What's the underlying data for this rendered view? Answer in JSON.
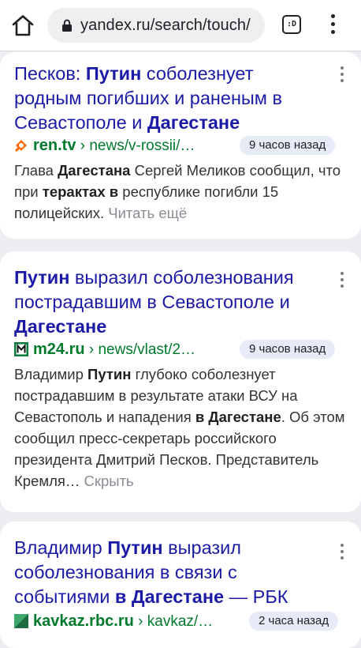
{
  "browser": {
    "url": "yandex.ru/search/touch/",
    "tab_label": ":D"
  },
  "results": [
    {
      "title_parts": [
        "Песков: ",
        "Путин",
        " соболезнует родным погибших и раненым в Севастополе и ",
        "Дагестане"
      ],
      "domain": "ren.tv",
      "path": "› news/v-rossii/…",
      "time": "9 часов назад",
      "snippet_parts": [
        "Глава ",
        "Дагестана",
        " Сергей Меликов сообщил, что при ",
        "терактах в",
        " республике погибли 15 полицейских."
      ],
      "more": "Читать ещё"
    },
    {
      "title_parts": [
        "Путин",
        " выразил соболезнования пострадавшим в Севастополе и ",
        "Дагестане"
      ],
      "domain": "m24.ru",
      "path": "› news/vlast/2…",
      "time": "9 часов назад",
      "snippet_parts": [
        "Владимир ",
        "Путин",
        " глубоко соболезнует пострадавшим в результате атаки ВСУ на Севастополь и нападения ",
        "в Дагестане",
        ". Об этом сообщил пресс-секретарь российского президента Дмитрий Песков. Представитель Кремля…"
      ],
      "more": "Скрыть"
    },
    {
      "title_parts": [
        "Владимир ",
        "Путин",
        " выразил соболезнования в связи с событиями ",
        "в Дагестане",
        " — РБК"
      ],
      "domain": "kavkaz.rbc.ru",
      "path": "› kavkaz/…",
      "time": "2 часа назад"
    }
  ],
  "colors": {
    "title": "#1a1aa6",
    "domain": "#007a2d",
    "background": "#ebedf0",
    "time_badge": "#e6ebf7"
  },
  "icons": [
    "home-icon",
    "lock-icon",
    "tabs-counter-icon",
    "overflow-menu-icon",
    "ren-tv-favicon",
    "m24-favicon",
    "rbc-favicon",
    "more-options-icon"
  ]
}
